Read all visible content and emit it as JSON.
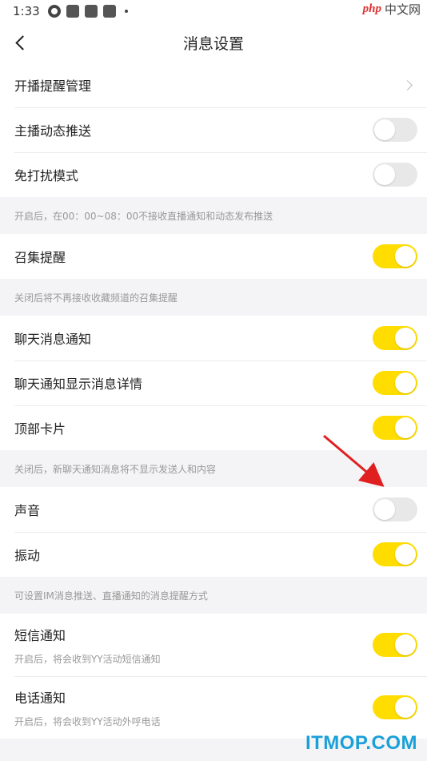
{
  "status_bar": {
    "time": "1:33"
  },
  "watermark_top": {
    "brand": "php",
    "text": "中文网"
  },
  "header": {
    "title": "消息设置"
  },
  "sections": [
    {
      "rows": [
        {
          "label": "开播提醒管理",
          "type": "link"
        },
        {
          "label": "主播动态推送",
          "type": "toggle",
          "on": false
        },
        {
          "label": "免打扰模式",
          "type": "toggle",
          "on": false
        }
      ],
      "note": "开启后，在00：00~08：00不接收直播通知和动态发布推送"
    },
    {
      "rows": [
        {
          "label": "召集提醒",
          "type": "toggle",
          "on": true
        }
      ],
      "note": "关闭后将不再接收收藏频道的召集提醒"
    },
    {
      "rows": [
        {
          "label": "聊天消息通知",
          "type": "toggle",
          "on": true
        },
        {
          "label": "聊天通知显示消息详情",
          "type": "toggle",
          "on": true
        },
        {
          "label": "顶部卡片",
          "type": "toggle",
          "on": true
        }
      ],
      "note": "关闭后，新聊天通知消息将不显示发送人和内容"
    },
    {
      "rows": [
        {
          "label": "声音",
          "type": "toggle",
          "on": false
        },
        {
          "label": "振动",
          "type": "toggle",
          "on": true
        }
      ],
      "note": "可设置IM消息推送、直播通知的消息提醒方式"
    },
    {
      "rows": [
        {
          "label": "短信通知",
          "sub": "开启后，将会收到YY活动短信通知",
          "type": "toggle",
          "on": true
        },
        {
          "label": "电话通知",
          "sub": "开启后，将会收到YY活动外呼电话",
          "type": "toggle",
          "on": true
        }
      ]
    }
  ],
  "watermark_bottom": "ITMOP.COM",
  "colors": {
    "toggle_on": "#ffdd00",
    "toggle_off": "#e8e8e8",
    "annotation_arrow": "#e02020"
  }
}
